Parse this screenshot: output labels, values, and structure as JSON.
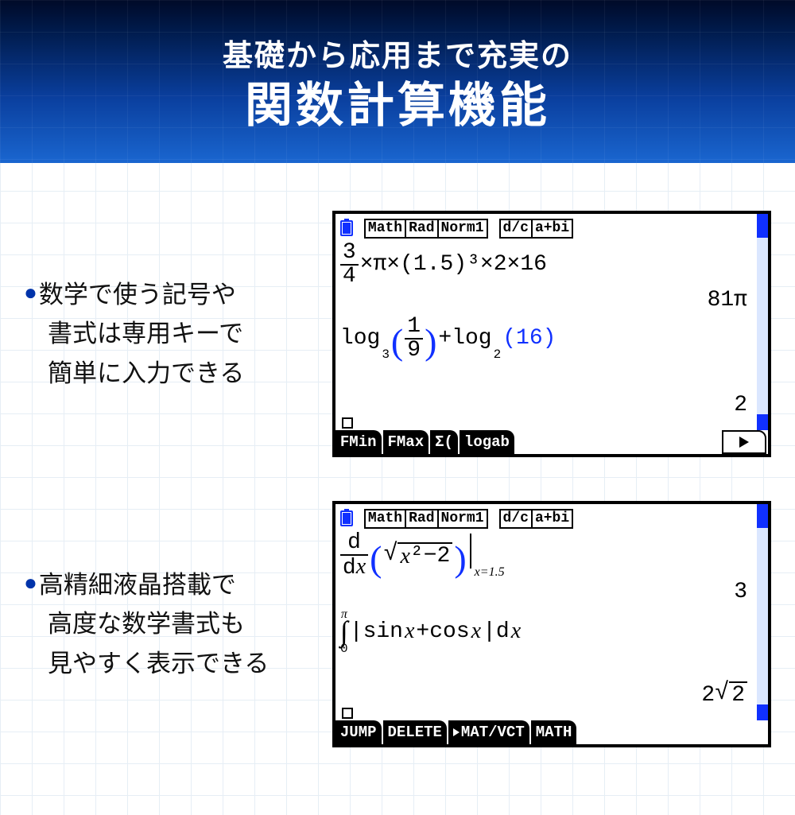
{
  "hero": {
    "sub": "基礎から応用まで充実の",
    "main": "関数計算機能"
  },
  "bullets": {
    "b1_l1": "数学で使う記号や",
    "b1_l2": "書式は専用キーで",
    "b1_l3": "簡単に入力できる",
    "b2_l1": "高精細液晶搭載で",
    "b2_l2": "高度な数学書式も",
    "b2_l3": "見やすく表示できる"
  },
  "lcd_status": {
    "math": "Math",
    "rad": "Rad",
    "norm": "Norm1",
    "dc": "d/c",
    "abi": "a+bi"
  },
  "lcd1": {
    "frac_n": "3",
    "frac_d": "4",
    "expr1_rest": "×π×(1.5)³×2×16",
    "res1": "81π",
    "log1_pre": "log",
    "log1_base": "3",
    "log1_arg_n": "1",
    "log1_arg_d": "9",
    "log2_pre": "+log",
    "log2_base": "2",
    "log2_arg": "(16)",
    "res2": "2",
    "softkeys": {
      "k1": "FMin",
      "k2": "FMax",
      "k3": "Σ(",
      "k4": "logab"
    }
  },
  "lcd2": {
    "dfrac_n": "d",
    "dfrac_d_pre": "d",
    "dfrac_d_var": "x",
    "sqrt_arg_var": "x",
    "sqrt_arg_rest": "²−2",
    "eval_at": "x=1.5",
    "res1": "3",
    "int_top": "π",
    "int_bot": "0",
    "int_body_a": "|sin ",
    "int_var1": "x",
    "int_body_b": "+cos ",
    "int_var2": "x",
    "int_body_c": "|d",
    "int_var3": "x",
    "res2_pre": "2",
    "res2_sqrt": "2",
    "softkeys": {
      "k1": "JUMP",
      "k2": "DELETE",
      "k3": "MAT/VCT",
      "k4": "MATH"
    }
  }
}
